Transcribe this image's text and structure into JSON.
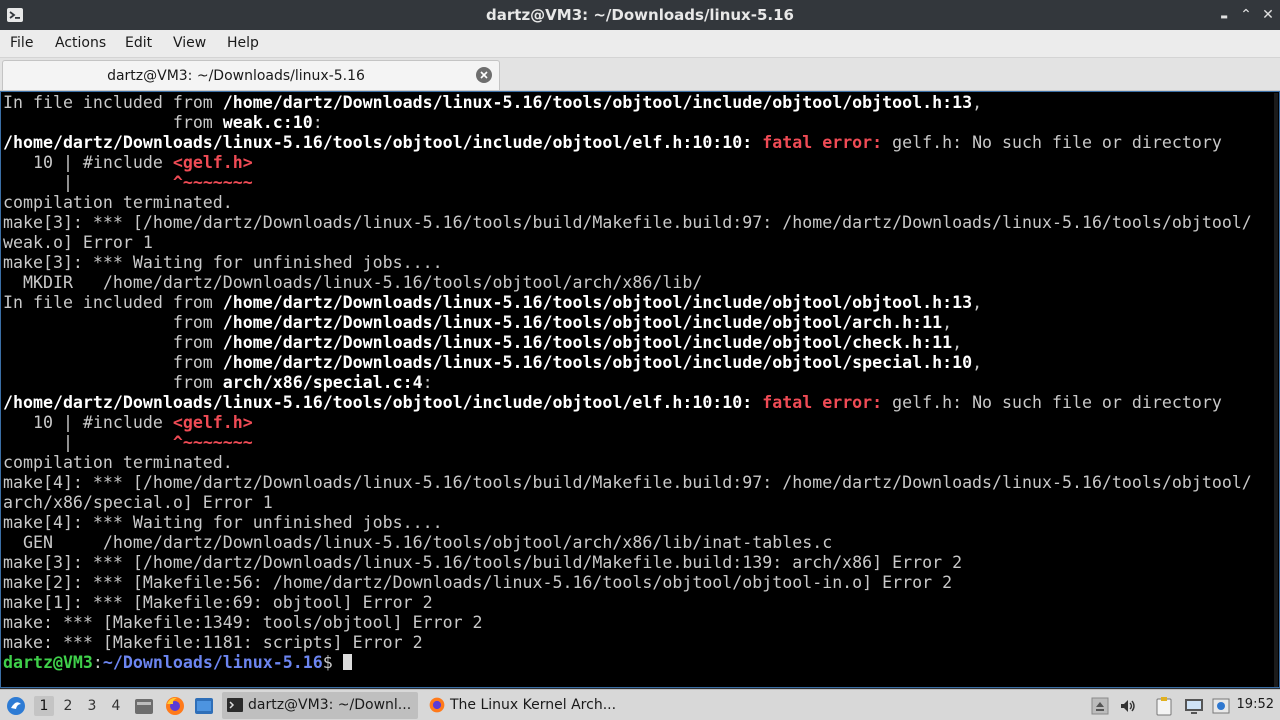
{
  "window": {
    "title": "dartz@VM3: ~/Downloads/linux-5.16",
    "minimize_glyph": "▬",
    "maximize_glyph": "⌃",
    "close_glyph": "✕"
  },
  "menu": {
    "file": "File",
    "actions": "Actions",
    "edit": "Edit",
    "view": "View",
    "help": "Help"
  },
  "tab": {
    "label": "dartz@VM3: ~/Downloads/linux-5.16"
  },
  "terminal": {
    "lines": [
      [
        {
          "t": "In file included from "
        },
        {
          "t": "/home/dartz/Downloads/linux-5.16/tools/objtool/include/objtool/objtool.h:13",
          "c": "b"
        },
        {
          "t": ","
        }
      ],
      [
        {
          "t": "                 from "
        },
        {
          "t": "weak.c:10",
          "c": "b"
        },
        {
          "t": ":"
        }
      ],
      [
        {
          "t": "/home/dartz/Downloads/linux-5.16/tools/objtool/include/objtool/elf.h:10:10: ",
          "c": "b"
        },
        {
          "t": "fatal error: ",
          "c": "r"
        },
        {
          "t": "gelf.h: No such file or directory"
        }
      ],
      [
        {
          "t": "   10 | #include "
        },
        {
          "t": "<gelf.h>",
          "c": "r"
        }
      ],
      [
        {
          "t": "      |          "
        },
        {
          "t": "^~~~~~~~",
          "c": "r"
        }
      ],
      [
        {
          "t": "compilation terminated."
        }
      ],
      [
        {
          "t": "make[3]: *** [/home/dartz/Downloads/linux-5.16/tools/build/Makefile.build:97: /home/dartz/Downloads/linux-5.16/tools/objtool/"
        }
      ],
      [
        {
          "t": "weak.o] Error 1"
        }
      ],
      [
        {
          "t": "make[3]: *** Waiting for unfinished jobs...."
        }
      ],
      [
        {
          "t": "  MKDIR   /home/dartz/Downloads/linux-5.16/tools/objtool/arch/x86/lib/"
        }
      ],
      [
        {
          "t": "In file included from "
        },
        {
          "t": "/home/dartz/Downloads/linux-5.16/tools/objtool/include/objtool/objtool.h:13",
          "c": "b"
        },
        {
          "t": ","
        }
      ],
      [
        {
          "t": "                 from "
        },
        {
          "t": "/home/dartz/Downloads/linux-5.16/tools/objtool/include/objtool/arch.h:11",
          "c": "b"
        },
        {
          "t": ","
        }
      ],
      [
        {
          "t": "                 from "
        },
        {
          "t": "/home/dartz/Downloads/linux-5.16/tools/objtool/include/objtool/check.h:11",
          "c": "b"
        },
        {
          "t": ","
        }
      ],
      [
        {
          "t": "                 from "
        },
        {
          "t": "/home/dartz/Downloads/linux-5.16/tools/objtool/include/objtool/special.h:10",
          "c": "b"
        },
        {
          "t": ","
        }
      ],
      [
        {
          "t": "                 from "
        },
        {
          "t": "arch/x86/special.c:4",
          "c": "b"
        },
        {
          "t": ":"
        }
      ],
      [
        {
          "t": "/home/dartz/Downloads/linux-5.16/tools/objtool/include/objtool/elf.h:10:10: ",
          "c": "b"
        },
        {
          "t": "fatal error: ",
          "c": "r"
        },
        {
          "t": "gelf.h: No such file or directory"
        }
      ],
      [
        {
          "t": "   10 | #include "
        },
        {
          "t": "<gelf.h>",
          "c": "r"
        }
      ],
      [
        {
          "t": "      |          "
        },
        {
          "t": "^~~~~~~~",
          "c": "r"
        }
      ],
      [
        {
          "t": "compilation terminated."
        }
      ],
      [
        {
          "t": "make[4]: *** [/home/dartz/Downloads/linux-5.16/tools/build/Makefile.build:97: /home/dartz/Downloads/linux-5.16/tools/objtool/"
        }
      ],
      [
        {
          "t": "arch/x86/special.o] Error 1"
        }
      ],
      [
        {
          "t": "make[4]: *** Waiting for unfinished jobs...."
        }
      ],
      [
        {
          "t": "  GEN     /home/dartz/Downloads/linux-5.16/tools/objtool/arch/x86/lib/inat-tables.c"
        }
      ],
      [
        {
          "t": "make[3]: *** [/home/dartz/Downloads/linux-5.16/tools/build/Makefile.build:139: arch/x86] Error 2"
        }
      ],
      [
        {
          "t": "make[2]: *** [Makefile:56: /home/dartz/Downloads/linux-5.16/tools/objtool/objtool-in.o] Error 2"
        }
      ],
      [
        {
          "t": "make[1]: *** [Makefile:69: objtool] Error 2"
        }
      ],
      [
        {
          "t": "make: *** [Makefile:1349: tools/objtool] Error 2"
        }
      ],
      [
        {
          "t": "make: *** [Makefile:1181: scripts] Error 2"
        }
      ]
    ],
    "prompt": {
      "user": "dartz@VM3",
      "sep": ":",
      "path": "~/Downloads/linux-5.16",
      "symbol": "$ "
    }
  },
  "taskbar": {
    "workspaces": [
      "1",
      "2",
      "3",
      "4"
    ],
    "tasks": [
      {
        "label": "dartz@VM3: ~/Downl..."
      },
      {
        "label": "The Linux Kernel Arch..."
      }
    ],
    "clock": "19:52"
  }
}
